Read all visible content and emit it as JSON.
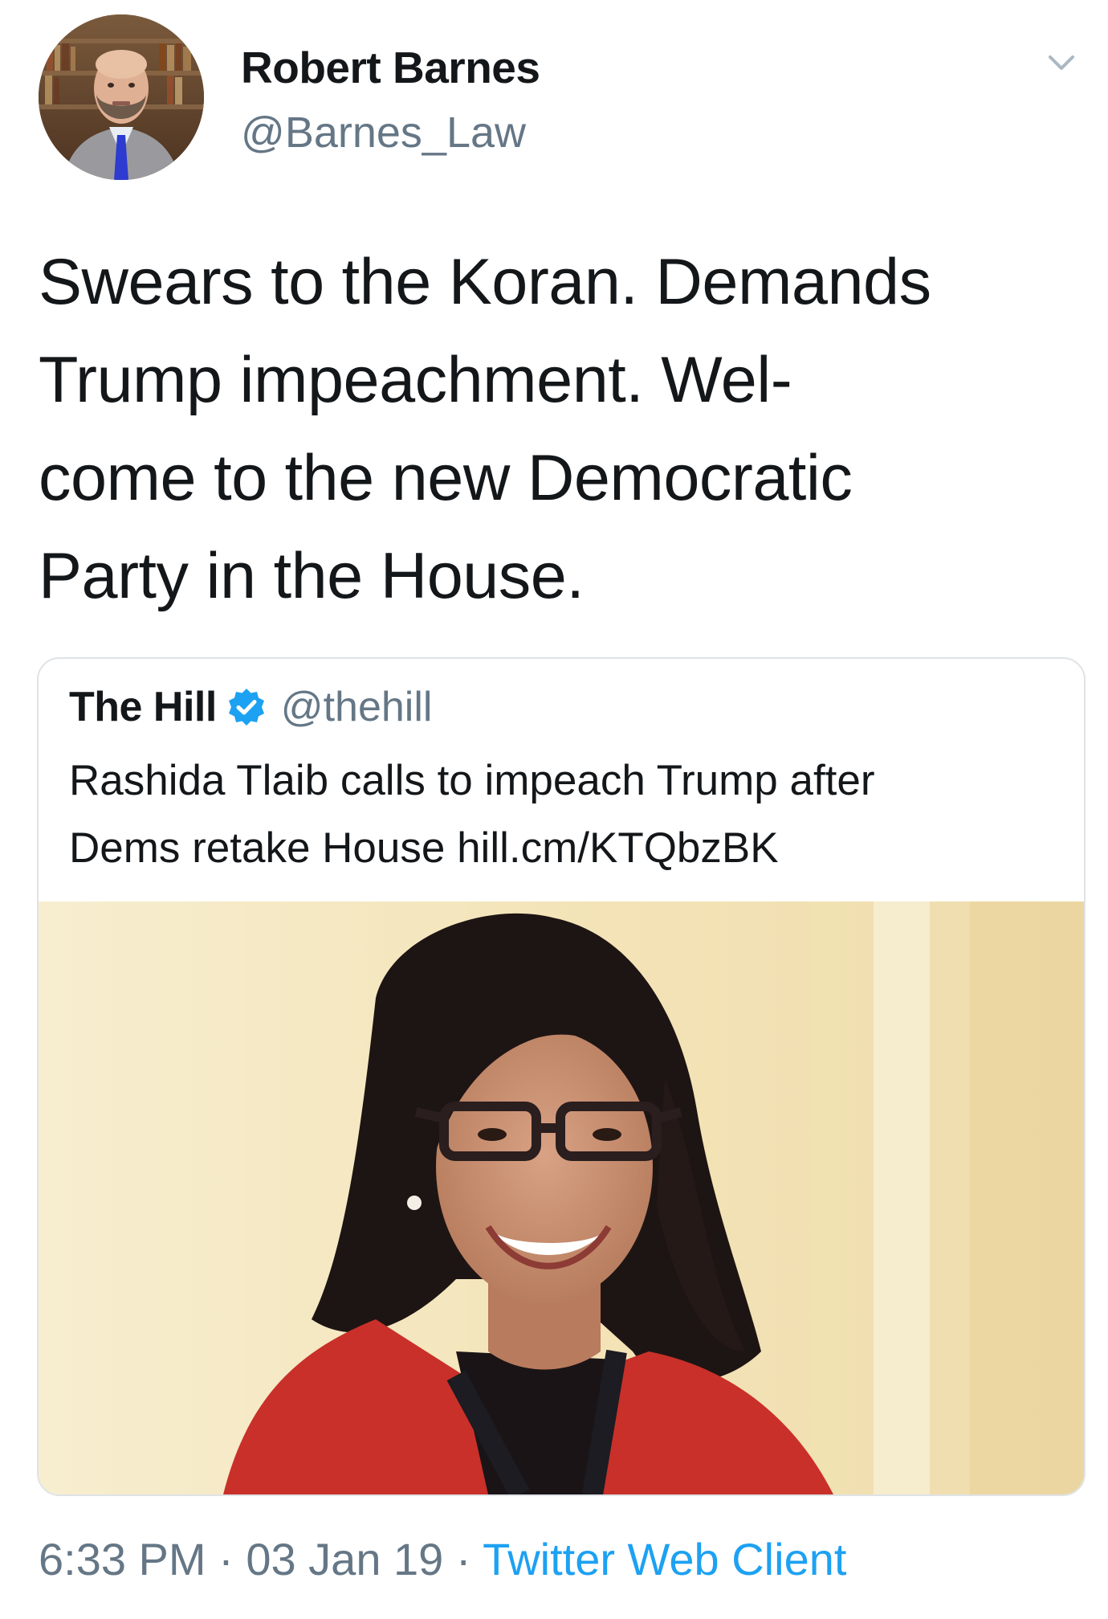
{
  "author": {
    "display_name": "Robert Barnes",
    "handle": "@Barnes_Law"
  },
  "tweet": {
    "lines": [
      "Swears to the Koran. Demands",
      "Trump impeachment. Wel-",
      "come to the new Democratic",
      "Party in the House."
    ]
  },
  "quoted_tweet": {
    "display_name": "The Hill",
    "handle": "@thehill",
    "verified": true,
    "text_lines": [
      "Rashida Tlaib calls to impeach Trump after",
      "Dems retake House hill.cm/KTQbzBK"
    ]
  },
  "meta": {
    "time": "6:33 PM",
    "separator1": " · ",
    "date": "03 Jan 19",
    "separator2": " · ",
    "client": "Twitter Web Client"
  },
  "icons": {
    "menu": "chevron-down-icon",
    "verified": "verified-badge-icon"
  },
  "colors": {
    "text": "#14171a",
    "secondary": "#657786",
    "link": "#1da1f2",
    "verified": "#1da1f2",
    "border": "#dfe3e6"
  }
}
